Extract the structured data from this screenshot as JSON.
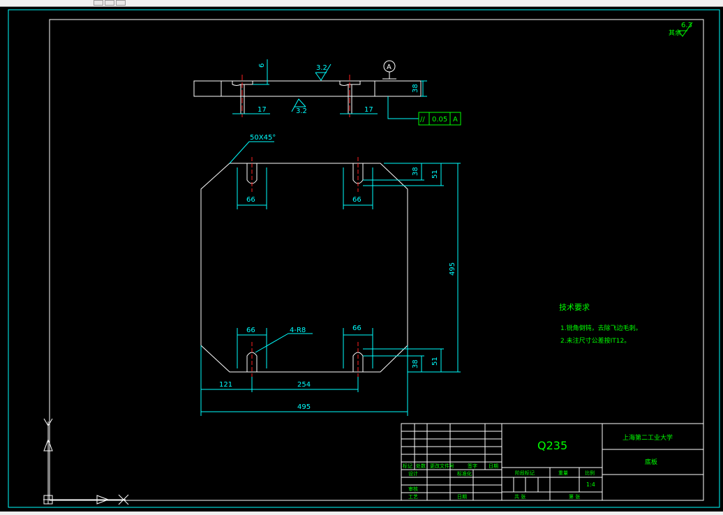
{
  "drawing": {
    "roughness": {
      "value": "6.3",
      "label": "其余"
    },
    "side_view": {
      "dim_height": "38",
      "dim_depth": "6",
      "dim_slot_left": "17",
      "dim_slot_right": "17",
      "rough_top": "3.2",
      "rough_bottom": "3.2",
      "datum": "A",
      "tol_symbol": "//",
      "tol_value": "0.05",
      "tol_datum": "A"
    },
    "plan_view": {
      "chamfer": "50X45°",
      "slot_w_tl": "66",
      "slot_w_tr": "66",
      "slot_w_bl": "66",
      "slot_w_br": "66",
      "slot_len_top": "38",
      "slot_off_top": "51",
      "slot_len_bot": "38",
      "slot_off_bot": "51",
      "radius": "4-R8",
      "height": "495",
      "dim_121": "121",
      "dim_254": "254",
      "width": "495"
    },
    "tech_req": {
      "title": "技术要求",
      "item1": "1.锐角倒钝，去除飞边毛刺。",
      "item2": "2.未注尺寸公差按IT12。"
    },
    "title_block": {
      "material": "Q235",
      "school": "上海第二工业大学",
      "part_name": "底板",
      "h_mark": "标记",
      "h_qty": "处数",
      "h_zone": "更改文件号",
      "h_sign": "签字",
      "h_date": "日期",
      "design": "设计",
      "standard": "标准化",
      "check": "审核",
      "process": "工艺",
      "approve": "日期",
      "stage": "阶段标记",
      "weight": "重量",
      "scale": "比例",
      "scale_value": "1:4",
      "sheets": "共   张",
      "sheet": "第   张"
    }
  },
  "colors": {
    "background": "#000000",
    "geometry": "#ffffff",
    "dimension": "#00ffff",
    "centerline": "#ff2020",
    "text": "#00ff00"
  }
}
